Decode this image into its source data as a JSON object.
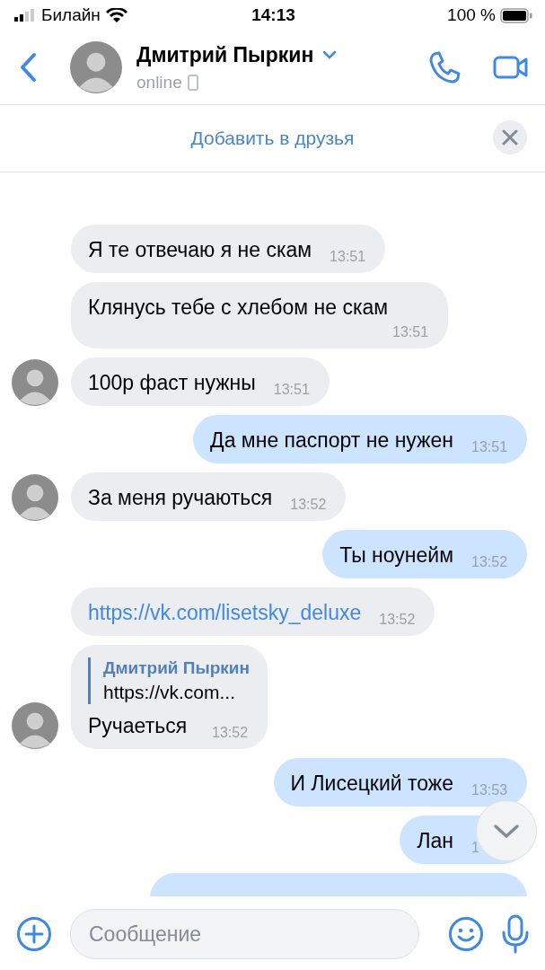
{
  "status_bar": {
    "carrier": "Билайн",
    "time": "14:13",
    "battery": "100 %"
  },
  "header": {
    "name": "Дмитрий Пыркин",
    "status": "online"
  },
  "banner": {
    "action": "Добавить в друзья"
  },
  "messages": [
    {
      "kind": "text",
      "outgoing": false,
      "avatar": false,
      "text": "Я те отвечаю я не скам",
      "time": "13:51"
    },
    {
      "kind": "text",
      "outgoing": false,
      "avatar": false,
      "text": "Клянусь тебе с хлебом не скам",
      "time": "13:51"
    },
    {
      "kind": "text",
      "outgoing": false,
      "avatar": true,
      "text": "100р фаст нужны",
      "time": "13:51"
    },
    {
      "kind": "text",
      "outgoing": true,
      "text": "Да мне паспорт не нужен",
      "time": "13:51"
    },
    {
      "kind": "text",
      "outgoing": false,
      "avatar": true,
      "text": "За меня ручаються",
      "time": "13:52"
    },
    {
      "kind": "text",
      "outgoing": true,
      "text": "Ты ноунейм",
      "time": "13:52"
    },
    {
      "kind": "link",
      "outgoing": false,
      "avatar": false,
      "text": "https://vk.com/lisetsky_deluxe",
      "time": "13:52"
    },
    {
      "kind": "reply",
      "outgoing": false,
      "avatar": true,
      "quote_author": "Дмитрий Пыркин",
      "quote_text": "https://vk.com...",
      "text": "Ручаеться",
      "time": "13:52"
    },
    {
      "kind": "text",
      "outgoing": true,
      "text": "И Лисецкий тоже",
      "time": "13:53"
    },
    {
      "kind": "text",
      "outgoing": true,
      "text": "Лан",
      "time": "1"
    },
    {
      "kind": "cut",
      "outgoing": true
    }
  ],
  "composer": {
    "placeholder": "Сообщение"
  }
}
